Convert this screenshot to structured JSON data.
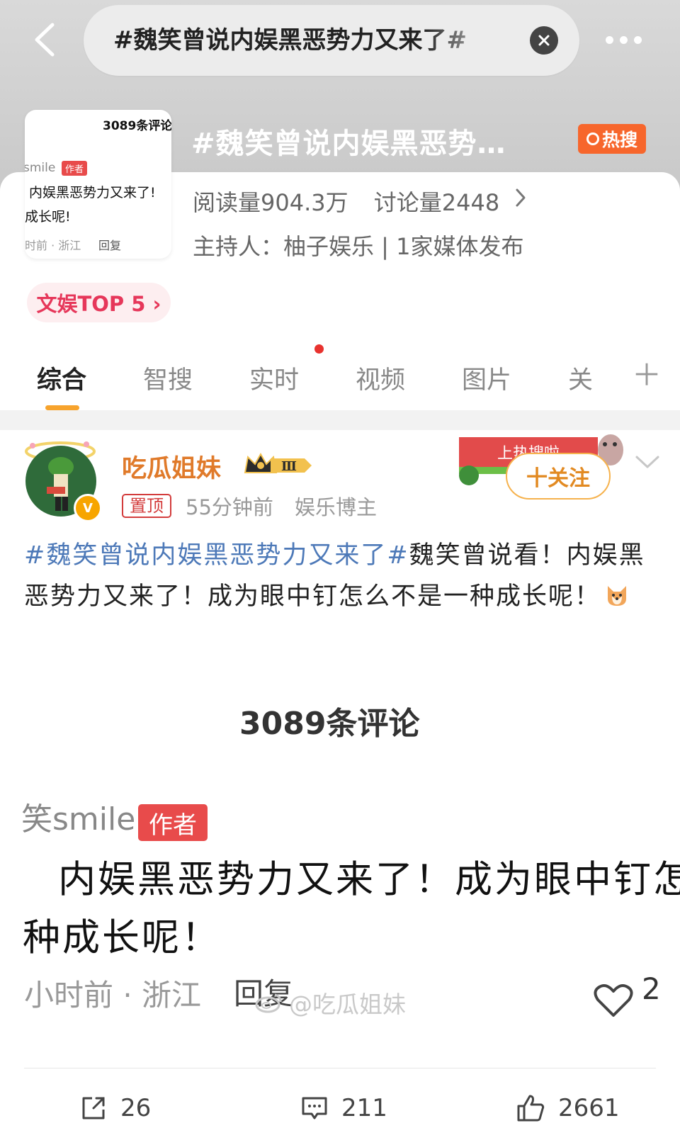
{
  "header": {
    "search_query": "#魏笑曾说内娱黑恶势力又来了#"
  },
  "topic": {
    "title": "#魏笑曾说内娱黑恶势…",
    "hot_label": "热搜",
    "reads": "阅读量904.3万",
    "discussions": "讨论量2448",
    "host": "主持人：柚子娱乐 | 1家媒体发布",
    "rank_badge": "文娱TOP 5 ›",
    "thumb": {
      "count": "3089条评论",
      "user": "smile",
      "author": "作者",
      "line1": "内娱黑恶势力又来了!",
      "line2": "成长呢!",
      "meta": "时前 · 浙江",
      "reply": "回复"
    }
  },
  "tabs": [
    {
      "label": "综合"
    },
    {
      "label": "智搜"
    },
    {
      "label": "实时"
    },
    {
      "label": "视频"
    },
    {
      "label": "图片"
    },
    {
      "label": "关"
    }
  ],
  "post": {
    "author": "吃瓜姐妹",
    "level": "Ⅲ",
    "pin": "置顶",
    "time": "55分钟前",
    "role": "娱乐博主",
    "follow": "十关注",
    "follow_deco": "上热搜啦",
    "text_tag": "#魏笑曾说内娱黑恶势力又来了#",
    "text_body": "魏笑曾说看！内娱黑恶势力又来了！成为眼中钉怎么不是一种成长呢！",
    "screenshot": {
      "count": "3089条评论",
      "user": "笑smile",
      "author": "作者",
      "line1": "内娱黑恶势力又来了！成为眼中钉怎",
      "line2": "种成长呢！",
      "meta": "小时前 · 浙江",
      "reply": "回复",
      "likes": "2",
      "watermark": "@吃瓜姐妹"
    },
    "actions": {
      "shares": "26",
      "comments": "211",
      "likes": "2661"
    }
  },
  "colors": {
    "accent_orange": "#f7a32c",
    "hot_badge": "#f7662c",
    "rank_pink": "#e6375a",
    "hashtag_blue": "#4d79b8",
    "author_red": "#e84b4b"
  }
}
